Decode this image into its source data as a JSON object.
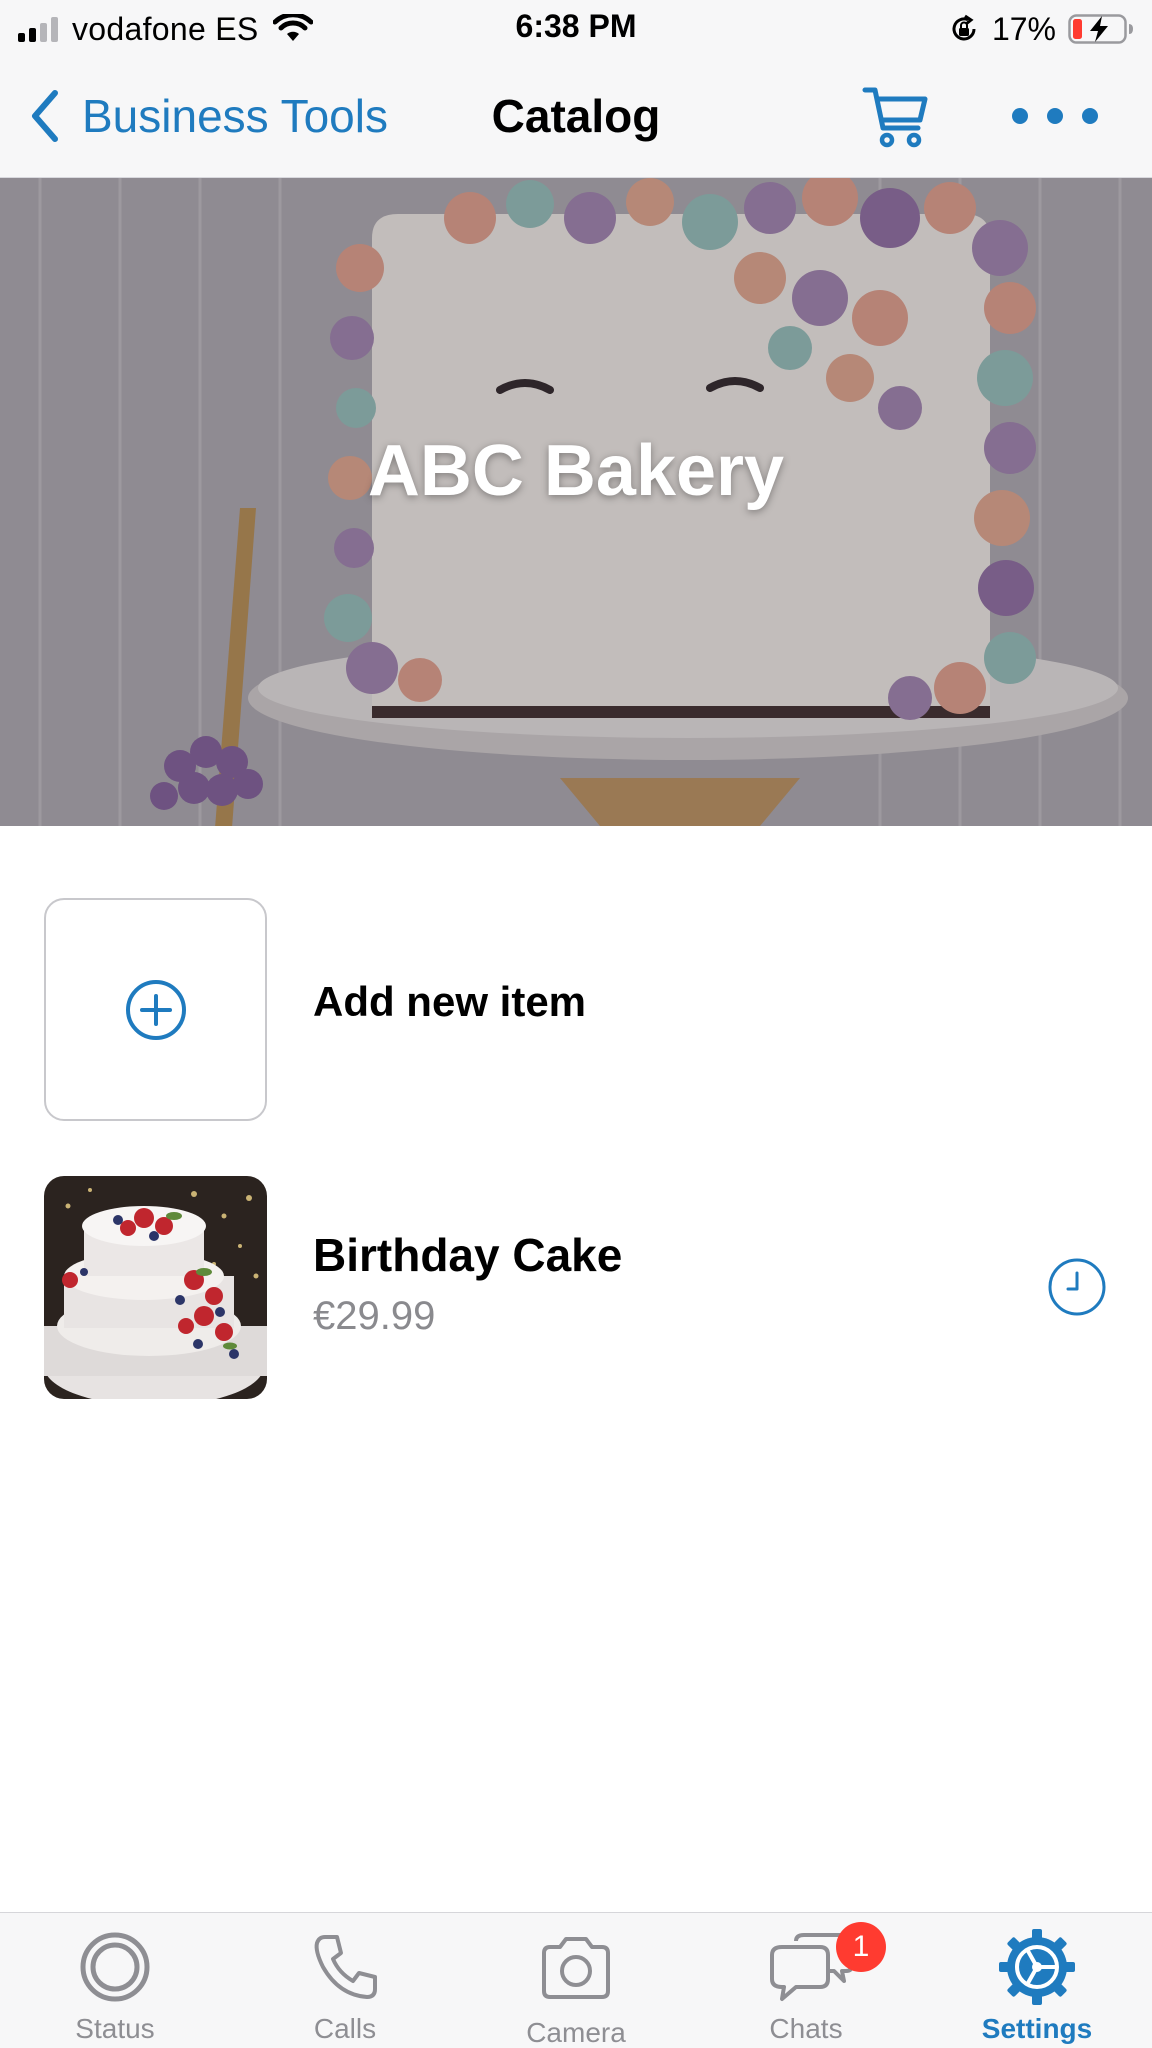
{
  "status_bar": {
    "carrier": "vodafone ES",
    "time": "6:38 PM",
    "battery_percent": "17%",
    "icons": [
      "signal-icon",
      "wifi-icon",
      "orientation-lock-icon",
      "battery-charging-icon"
    ]
  },
  "nav": {
    "back_label": "Business Tools",
    "title": "Catalog",
    "accent_color": "#1f7bbf",
    "icons": [
      "chevron-left-icon",
      "cart-icon",
      "more-icon"
    ]
  },
  "cover": {
    "title": "ABC Bakery"
  },
  "catalog": {
    "add_item_label": "Add new item",
    "items": [
      {
        "name": "Birthday Cake",
        "price": "€29.99",
        "status_icon": "clock-icon"
      }
    ]
  },
  "tab_bar": {
    "tabs": [
      {
        "label": "Status",
        "icon": "status-icon",
        "active": false
      },
      {
        "label": "Calls",
        "icon": "phone-icon",
        "active": false
      },
      {
        "label": "Camera",
        "icon": "camera-icon",
        "active": false
      },
      {
        "label": "Chats",
        "icon": "chats-icon",
        "active": false
      },
      {
        "label": "Settings",
        "icon": "gear-icon",
        "active": true
      }
    ],
    "chats_badge": "1",
    "badge_color": "#ff3b30"
  }
}
